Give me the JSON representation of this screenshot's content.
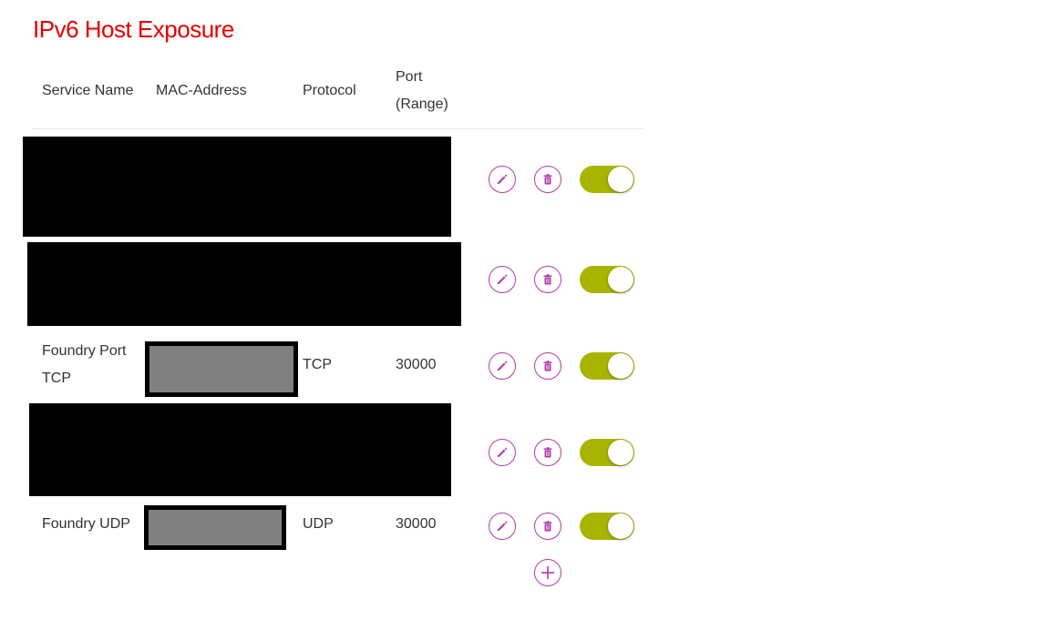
{
  "page": {
    "title": "IPv6 Host Exposure"
  },
  "colors": {
    "accent": "#b23aa9",
    "toggle_on": "#a8b400",
    "title": "#e60000"
  },
  "table": {
    "headers": {
      "service_name": "Service Name",
      "mac_address": "MAC-Address",
      "protocol": "Protocol",
      "port_line1": "Port",
      "port_line2": "(Range)"
    },
    "rows": [
      {
        "redacted": true,
        "enabled": true
      },
      {
        "redacted": true,
        "enabled": true
      },
      {
        "redacted": false,
        "service_line1": "Foundry Port",
        "service_line2": "TCP",
        "mac_redacted": true,
        "protocol": "TCP",
        "port": "30000",
        "enabled": true
      },
      {
        "redacted": true,
        "enabled": true
      },
      {
        "redacted": false,
        "service_line1": "Foundry UDP",
        "mac_redacted": true,
        "protocol": "UDP",
        "port": "30000",
        "enabled": true
      }
    ]
  },
  "icons": {
    "edit": "pencil-icon",
    "delete": "trash-icon",
    "add": "plus-icon",
    "toggle": "toggle-switch"
  }
}
